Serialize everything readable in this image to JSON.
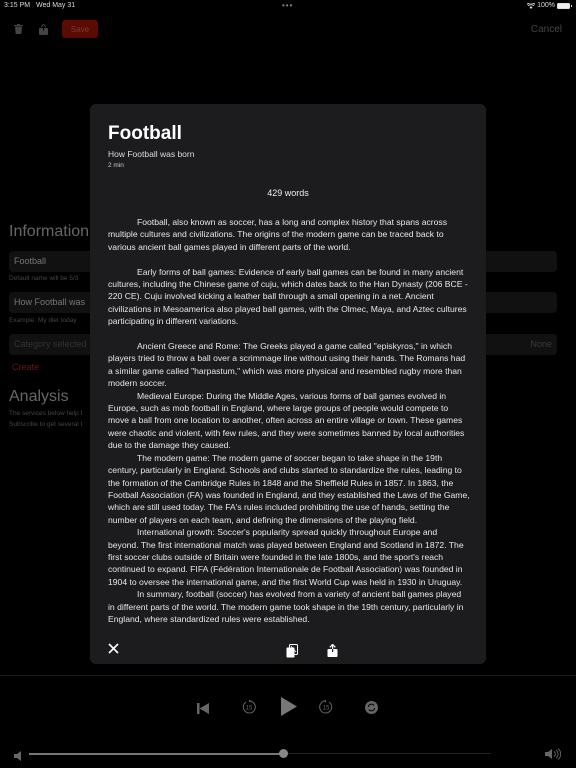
{
  "status_bar": {
    "time": "3:15 PM",
    "date": "Wed May 31",
    "battery": "100%"
  },
  "toolbar": {
    "save_label": "Save",
    "cancel_label": "Cancel"
  },
  "form": {
    "information_title": "Information",
    "name_value": "Football",
    "name_hint": "Default name will be 5/3",
    "description_value": "How Football was",
    "description_hint": "Example: My diet today",
    "category_placeholder": "Category selected",
    "category_value": "None",
    "create_label": "Create",
    "analysis_title": "Analysis",
    "analysis_line1": "The services below help t",
    "analysis_line2": "Subscribe to get several t"
  },
  "modal": {
    "title": "Football",
    "subtitle": "How Football was born",
    "duration": "2 min",
    "word_count": "429 words",
    "paragraphs": [
      "Football, also known as soccer, has a long and complex history that spans across multiple cultures and civilizations. The origins of the modern game can be traced back to various ancient ball games played in different parts of the world.",
      "Early forms of ball games: Evidence of early ball games can be found in many ancient cultures, including the Chinese game of cuju, which dates back to the Han Dynasty (206 BCE - 220 CE). Cuju involved kicking a leather ball through a small opening in a net. Ancient civilizations in Mesoamerica also played ball games, with the Olmec, Maya, and Aztec cultures participating in different variations.",
      "Ancient Greece and Rome: The Greeks played a game called \"episkyros,\" in which players tried to throw a ball over a scrimmage line without using their hands. The Romans had a similar game called \"harpastum,\" which was more physical and resembled rugby more than modern soccer.",
      "Medieval Europe: During the Middle Ages, various forms of ball games evolved in Europe, such as mob football in England, where large groups of people would compete to move a ball from one location to another, often across an entire village or town. These games were chaotic and violent, with few rules, and they were sometimes banned by local authorities due to the damage they caused.",
      "The modern game: The modern game of soccer began to take shape in the 19th century, particularly in England. Schools and clubs started to standardize the rules, leading to the formation of the Cambridge Rules in 1848 and the Sheffield Rules in 1857. In 1863, the Football Association (FA) was founded in England, and they established the Laws of the Game, which are still used today. The FA's rules included prohibiting the use of hands, setting the number of players on each team, and defining the dimensions of the playing field.",
      "International growth: Soccer's popularity spread quickly throughout Europe and beyond. The first international match was played between England and Scotland in 1872. The first soccer clubs outside of Britain were founded in the late 1800s, and the sport's reach continued to expand. FIFA (Fédération Internationale de Football Association) was founded in 1904 to oversee the international game, and the first World Cup was held in 1930 in Uruguay.",
      "In summary, football (soccer) has evolved from a variety of ancient ball games played in different parts of the world. The modern game took shape in the 19th century, particularly in England, where standardized rules were established."
    ],
    "icons": {
      "close": "close-icon",
      "copy": "copy-icon",
      "share": "share-icon"
    }
  },
  "player": {
    "icons": [
      "skip-back-icon",
      "rewind-15-icon",
      "play-icon",
      "forward-15-icon",
      "repeat-icon"
    ],
    "skip_label": "15",
    "volume_level": 0.55
  },
  "colors": {
    "accent_red": "#5c0a04",
    "modal_bg": "#1c1c1e",
    "background": "#000000"
  }
}
